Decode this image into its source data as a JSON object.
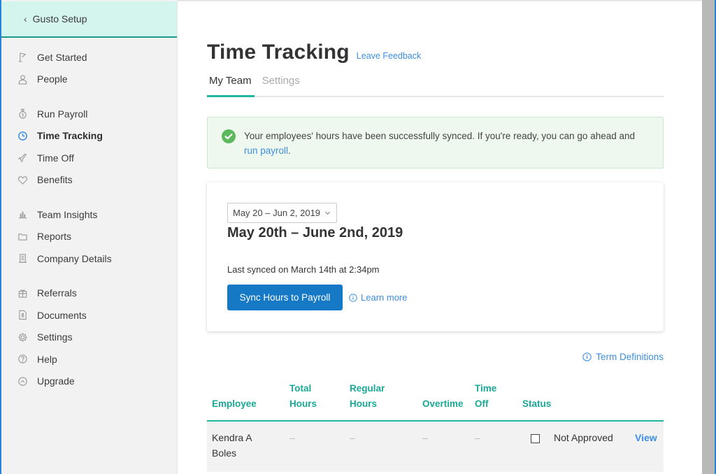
{
  "sidebar": {
    "back_label": "Gusto Setup",
    "groups": [
      [
        {
          "label": "Get Started",
          "icon": "flag-icon"
        },
        {
          "label": "People",
          "icon": "person-icon"
        }
      ],
      [
        {
          "label": "Run Payroll",
          "icon": "money-bag-icon"
        },
        {
          "label": "Time Tracking",
          "icon": "clock-icon",
          "active": true
        },
        {
          "label": "Time Off",
          "icon": "airplane-icon"
        },
        {
          "label": "Benefits",
          "icon": "heart-icon"
        }
      ],
      [
        {
          "label": "Team Insights",
          "icon": "bar-chart-icon"
        },
        {
          "label": "Reports",
          "icon": "folder-icon"
        },
        {
          "label": "Company Details",
          "icon": "building-icon"
        }
      ],
      [
        {
          "label": "Referrals",
          "icon": "gift-icon"
        },
        {
          "label": "Documents",
          "icon": "document-icon"
        },
        {
          "label": "Settings",
          "icon": "gear-icon"
        },
        {
          "label": "Help",
          "icon": "help-icon"
        },
        {
          "label": "Upgrade",
          "icon": "upgrade-icon"
        }
      ]
    ]
  },
  "header": {
    "title": "Time Tracking",
    "feedback_link": "Leave Feedback"
  },
  "tabs": [
    {
      "label": "My Team",
      "active": true
    },
    {
      "label": "Settings",
      "active": false
    }
  ],
  "alert": {
    "text_before": "Your employees' hours have been successfully synced. If you're ready, you can go ahead and ",
    "link": "run payroll",
    "text_after": "."
  },
  "period_card": {
    "select_value": "May 20 – Jun 2, 2019",
    "range_title": "May 20th – June 2nd, 2019",
    "last_synced": "Last synced on March 14th at 2:34pm",
    "sync_button": "Sync Hours to Payroll",
    "learn_more": "Learn more"
  },
  "term_definitions": "Term Definitions",
  "table": {
    "columns": [
      {
        "line1": "",
        "line2": "Employee"
      },
      {
        "line1": "Total",
        "line2": "Hours"
      },
      {
        "line1": "Regular",
        "line2": "Hours"
      },
      {
        "line1": "",
        "line2": "Overtime"
      },
      {
        "line1": "Time",
        "line2": "Off"
      },
      {
        "line1": "",
        "line2": "Status"
      }
    ],
    "rows": [
      {
        "employee_line1": "Kendra A",
        "employee_line2": "Boles",
        "total_hours": "–",
        "regular_hours": "–",
        "overtime": "–",
        "time_off": "–",
        "approved": false,
        "status": "Not Approved",
        "action": "View"
      }
    ]
  },
  "colors": {
    "accent_teal": "#1aa896",
    "link_blue": "#3d8ee0",
    "primary_button": "#1579c6",
    "success_green": "#5cb85c",
    "sidebar_header_bg": "#d4f4ee"
  }
}
